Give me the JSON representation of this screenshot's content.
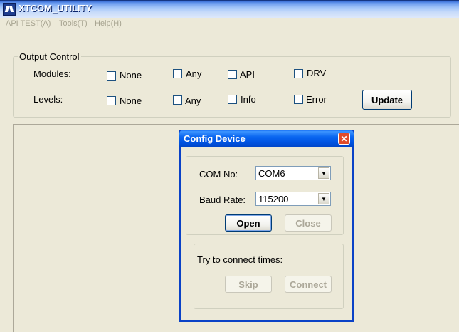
{
  "app": {
    "title": "XTCOM_UTILITY"
  },
  "menu": [
    "API TEST(A)",
    "Tools(T)",
    "Help(H)"
  ],
  "output_control": {
    "legend": "Output Control",
    "modules_label": "Modules:",
    "levels_label": "Levels:",
    "modules": [
      "None",
      "Any",
      "API",
      "DRV"
    ],
    "levels": [
      "None",
      "Any",
      "Info",
      "Error"
    ],
    "update_label": "Update"
  },
  "dialog": {
    "title": "Config Device",
    "close_glyph": "✕",
    "com_label": "COM No:",
    "com_value": "COM6",
    "baud_label": "Baud Rate:",
    "baud_value": "115200",
    "open_label": "Open",
    "close_label": "Close",
    "connect_prompt": "Try to connect times:",
    "skip_label": "Skip",
    "connect_label": "Connect"
  }
}
